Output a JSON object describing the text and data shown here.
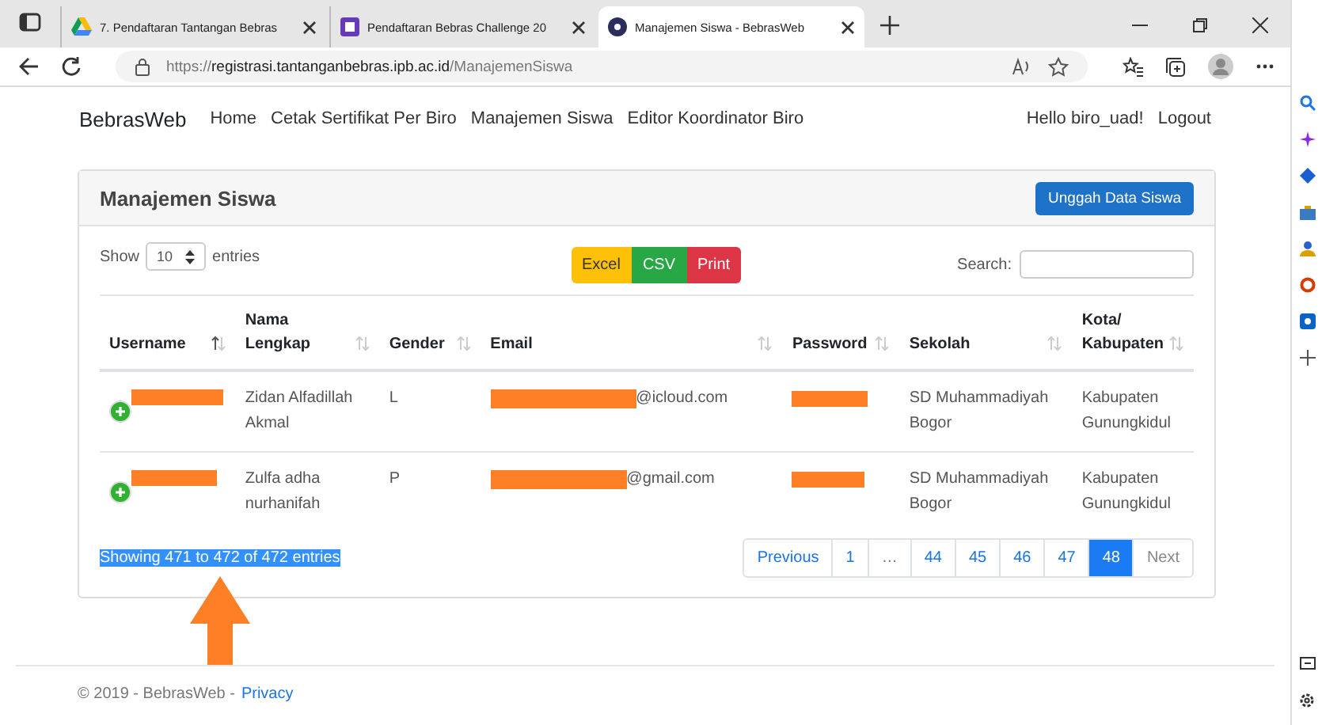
{
  "browser": {
    "tabs": [
      {
        "title": "7. Pendaftaran Tantangan Bebras",
        "selected": false
      },
      {
        "title": "Pendaftaran Bebras Challenge 20",
        "selected": false
      },
      {
        "title": "Manajemen Siswa - BebrasWeb",
        "selected": true
      }
    ],
    "url": {
      "prefix": "https://",
      "host": "registrasi.tantanganbebras.ipb.ac.id",
      "path": "/ManajemenSiswa"
    }
  },
  "navbar": {
    "brand": "BebrasWeb",
    "links": [
      "Home",
      "Cetak Sertifikat Per Biro",
      "Manajemen Siswa",
      "Editor Koordinator Biro"
    ],
    "greeting": "Hello biro_uad!",
    "logout": "Logout"
  },
  "card": {
    "title": "Manajemen Siswa",
    "upload_button": "Unggah Data Siswa",
    "length": {
      "before": "Show",
      "value": "10",
      "after": "entries"
    },
    "export_buttons": [
      {
        "label": "Excel",
        "kind": "excel"
      },
      {
        "label": "CSV",
        "kind": "csv"
      },
      {
        "label": "Print",
        "kind": "print"
      }
    ],
    "search_label": "Search:",
    "columns": [
      {
        "label": "Username",
        "sorted": true
      },
      {
        "label": "Nama Lengkap",
        "sorted": false
      },
      {
        "label": "Gender",
        "sorted": false
      },
      {
        "label": "Email",
        "sorted": false
      },
      {
        "label": "Password",
        "sorted": false
      },
      {
        "label": "Sekolah",
        "sorted": false
      },
      {
        "label": "Kota/ Kabupaten",
        "sorted": false
      }
    ],
    "rows": [
      {
        "name": "Zidan Alfadillah Akmal",
        "gender": "L",
        "email_domain": "@icloud.com",
        "school": "SD Muhammadiyah Bogor",
        "city": "Kabupaten Gunungkidul"
      },
      {
        "name": "Zulfa adha nurhanifah",
        "gender": "P",
        "email_domain": "@gmail.com",
        "school": "SD Muhammadiyah Bogor",
        "city": "Kabupaten Gunungkidul"
      }
    ],
    "info": {
      "text": "Showing 471 to 472 of 472 entries",
      "selected": true
    },
    "pagination": [
      {
        "label": "Previous",
        "kind": "nav",
        "selected": false
      },
      {
        "label": "1",
        "kind": "page",
        "selected": false
      },
      {
        "label": "…",
        "kind": "ellipsis",
        "selected": false
      },
      {
        "label": "44",
        "kind": "page",
        "selected": false
      },
      {
        "label": "45",
        "kind": "page",
        "selected": false
      },
      {
        "label": "46",
        "kind": "page",
        "selected": false
      },
      {
        "label": "47",
        "kind": "page",
        "selected": false
      },
      {
        "label": "48",
        "kind": "page",
        "selected": true
      },
      {
        "label": "Next",
        "kind": "disabled",
        "selected": false
      }
    ]
  },
  "footer": {
    "text": "© 2019 - BebrasWeb -",
    "link": "Privacy"
  }
}
